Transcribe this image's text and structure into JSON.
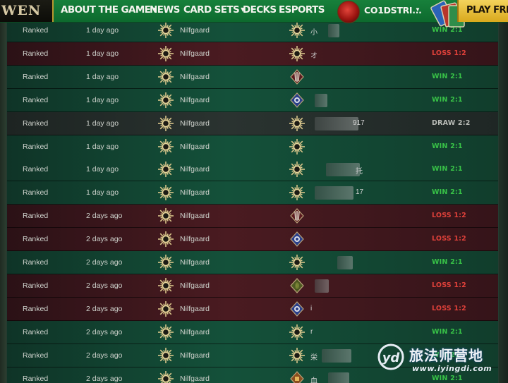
{
  "nav": {
    "logo": "WEN",
    "items": [
      {
        "label": "ABOUT THE GAME",
        "dropdown": true
      },
      {
        "label": "NEWS",
        "dropdown": false
      },
      {
        "label": "CARD SETS",
        "dropdown": true
      },
      {
        "label": "DECKS",
        "dropdown": false
      },
      {
        "label": "ESPORTS",
        "dropdown": false
      }
    ],
    "username": "CO1DSTRI...",
    "play_label": "PLAY FREE"
  },
  "colors": {
    "nav_green": "#17803b",
    "play_gold": "#e8bf3a",
    "win": "#38c247",
    "loss": "#e0413a",
    "draw": "#b8bbb6"
  },
  "matches": [
    {
      "mode": "Ranked",
      "time": "1 day ago",
      "faction": "Nilfgaard",
      "opp_icon": "nilfgaard-sun-icon",
      "opp_name": "小",
      "result": "WIN 2:1",
      "outcome": "win"
    },
    {
      "mode": "Ranked",
      "time": "1 day ago",
      "faction": "Nilfgaard",
      "opp_icon": "nilfgaard-sun-icon",
      "opp_name": "オ",
      "result": "LOSS 1:2",
      "outcome": "loss"
    },
    {
      "mode": "Ranked",
      "time": "1 day ago",
      "faction": "Nilfgaard",
      "opp_icon": "monsters-claw-icon",
      "opp_name": "",
      "result": "WIN 2:1",
      "outcome": "win"
    },
    {
      "mode": "Ranked",
      "time": "1 day ago",
      "faction": "Nilfgaard",
      "opp_icon": "northern-realms-icon",
      "opp_name": "",
      "result": "WIN 2:1",
      "outcome": "win"
    },
    {
      "mode": "Ranked",
      "time": "1 day ago",
      "faction": "Nilfgaard",
      "opp_icon": "nilfgaard-sun-icon",
      "opp_name": "917",
      "result": "DRAW 2:2",
      "outcome": "draw"
    },
    {
      "mode": "Ranked",
      "time": "1 day ago",
      "faction": "Nilfgaard",
      "opp_icon": "nilfgaard-sun-icon",
      "opp_name": "",
      "result": "WIN 2:1",
      "outcome": "win"
    },
    {
      "mode": "Ranked",
      "time": "1 day ago",
      "faction": "Nilfgaard",
      "opp_icon": "nilfgaard-sun-icon",
      "opp_name": "托",
      "result": "WIN 2:1",
      "outcome": "win"
    },
    {
      "mode": "Ranked",
      "time": "1 day ago",
      "faction": "Nilfgaard",
      "opp_icon": "nilfgaard-sun-icon",
      "opp_name": "17",
      "result": "WIN 2:1",
      "outcome": "win"
    },
    {
      "mode": "Ranked",
      "time": "2 days ago",
      "faction": "Nilfgaard",
      "opp_icon": "monsters-claw-icon",
      "opp_name": "",
      "result": "LOSS 1:2",
      "outcome": "loss"
    },
    {
      "mode": "Ranked",
      "time": "2 days ago",
      "faction": "Nilfgaard",
      "opp_icon": "northern-realms-icon",
      "opp_name": "",
      "result": "LOSS 1:2",
      "outcome": "loss"
    },
    {
      "mode": "Ranked",
      "time": "2 days ago",
      "faction": "Nilfgaard",
      "opp_icon": "nilfgaard-sun-icon",
      "opp_name": "",
      "result": "WIN 2:1",
      "outcome": "win"
    },
    {
      "mode": "Ranked",
      "time": "2 days ago",
      "faction": "Nilfgaard",
      "opp_icon": "scoiatael-leaf-icon",
      "opp_name": "",
      "result": "LOSS 1:2",
      "outcome": "loss"
    },
    {
      "mode": "Ranked",
      "time": "2 days ago",
      "faction": "Nilfgaard",
      "opp_icon": "northern-realms-icon",
      "opp_name": "i",
      "result": "LOSS 1:2",
      "outcome": "loss"
    },
    {
      "mode": "Ranked",
      "time": "2 days ago",
      "faction": "Nilfgaard",
      "opp_icon": "nilfgaard-sun-icon",
      "opp_name": "r",
      "result": "WIN 2:1",
      "outcome": "win"
    },
    {
      "mode": "Ranked",
      "time": "2 days ago",
      "faction": "Nilfgaard",
      "opp_icon": "nilfgaard-sun-icon",
      "opp_name": "栄",
      "result": "WIN 2:1",
      "outcome": "win"
    },
    {
      "mode": "Ranked",
      "time": "2 days ago",
      "faction": "Nilfgaard",
      "opp_icon": "syndicate-icon",
      "opp_name": "血",
      "result": "WIN 2:1",
      "outcome": "win"
    }
  ],
  "watermark": {
    "logo": "yd",
    "text": "旅法师营地",
    "url": "www.iyingdi.com"
  }
}
